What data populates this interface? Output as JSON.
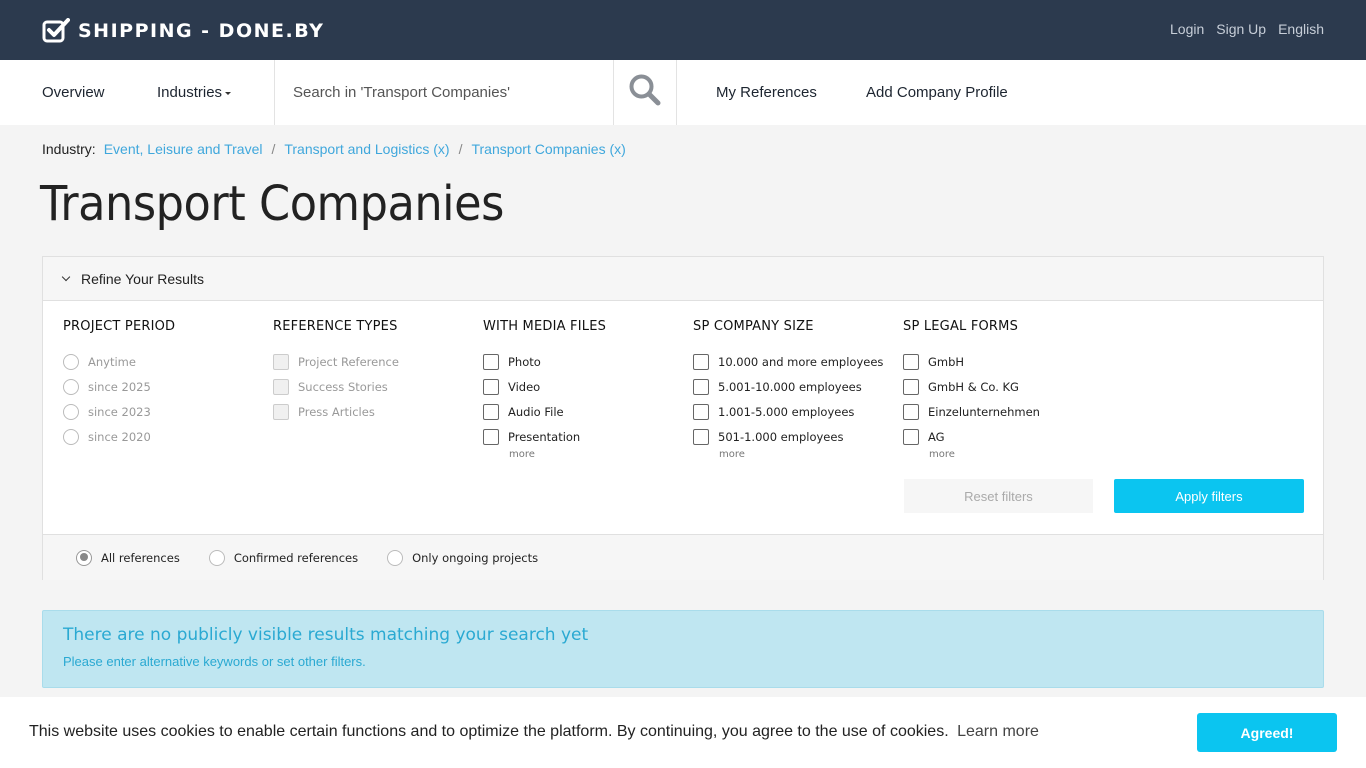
{
  "header": {
    "logo_text": "SHIPPING - DONE.BY",
    "links": [
      "Login",
      "Sign Up",
      "English"
    ]
  },
  "nav": {
    "overview": "Overview",
    "industries": "Industries",
    "search_placeholder": "Search in 'Transport Companies'",
    "my_references": "My References",
    "add_company_profile": "Add Company Profile"
  },
  "breadcrumb": {
    "label": "Industry:",
    "items": [
      "Event, Leisure and Travel",
      "Transport and Logistics (x)",
      "Transport Companies (x)"
    ],
    "separator": "/"
  },
  "page_title": "Transport Companies",
  "filters": {
    "title": "Refine Your Results",
    "project_period": {
      "heading": "PROJECT PERIOD",
      "options": [
        "Anytime",
        "since 2025",
        "since 2023",
        "since 2020"
      ]
    },
    "reference_types": {
      "heading": "REFERENCE TYPES",
      "options": [
        "Project Reference",
        "Success Stories",
        "Press Articles"
      ]
    },
    "media_files": {
      "heading": "WITH MEDIA FILES",
      "options": [
        "Photo",
        "Video",
        "Audio File",
        "Presentation"
      ],
      "more": "more"
    },
    "company_size": {
      "heading": "SP COMPANY SIZE",
      "options": [
        "10.000 and more employees",
        "5.001-10.000 employees",
        "1.001-5.000 employees",
        "501-1.000 employees"
      ],
      "more": "more"
    },
    "legal_forms": {
      "heading": "SP LEGAL FORMS",
      "options": [
        "GmbH",
        "GmbH & Co. KG",
        "Einzelunternehmen",
        "AG"
      ],
      "more": "more"
    },
    "reset_label": "Reset filters",
    "apply_label": "Apply filters",
    "scope": {
      "options": [
        "All references",
        "Confirmed references",
        "Only ongoing projects"
      ],
      "selected": "All references"
    }
  },
  "notice": {
    "title": "There are no publicly visible results matching your search yet",
    "text": "Please enter alternative keywords or set other filters."
  },
  "cookie": {
    "message": "This website uses cookies to enable certain functions and to optimize the platform. By continuing, you agree to the use of cookies.",
    "learn_more": "Learn more",
    "button": "Agreed!"
  },
  "colors": {
    "topbar": "#2c3a4e",
    "accent": "#0bc5f0",
    "link": "#3fa7dc",
    "notice_bg": "#bfe6f1"
  }
}
